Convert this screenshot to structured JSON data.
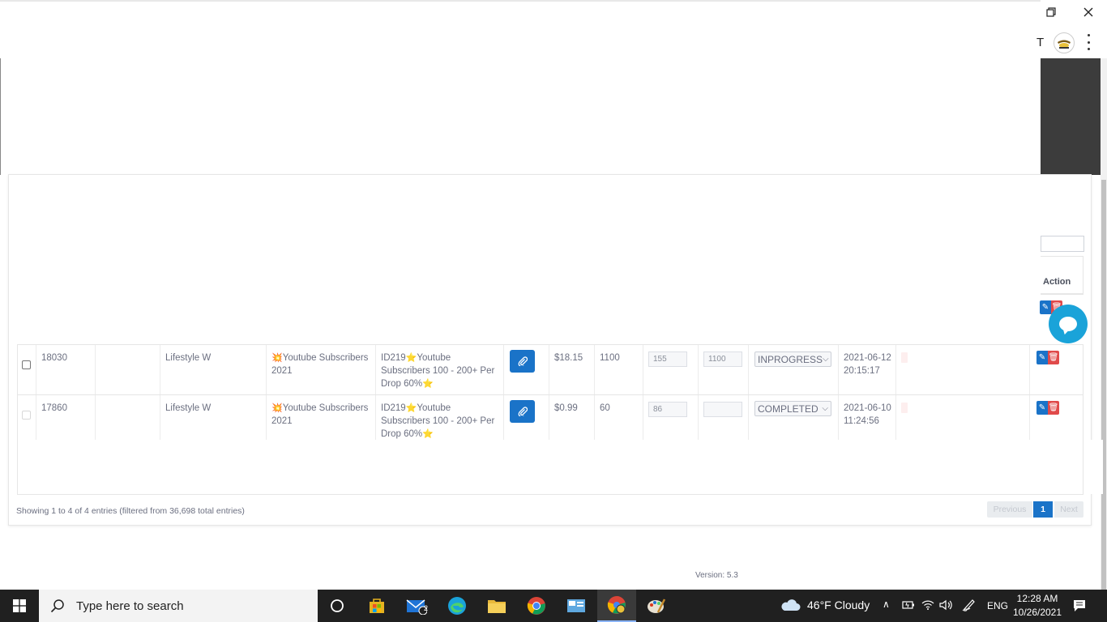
{
  "browser": {
    "partial_text": "T"
  },
  "table": {
    "action_header": "Action",
    "rows": [
      {
        "id": "18030",
        "user": "",
        "category": "Lifestyle W",
        "service_emoji": "💥",
        "service": "Youtube Subscribers 2021",
        "detail_prefix": "ID219",
        "detail_main": "Youtube Subscribers 100 - 200+ Per Drop 60%",
        "charge": "$18.15",
        "quantity": "1100",
        "start_count": "155",
        "remains": "1100",
        "status": "INPROGRESS",
        "date": "2021-06-12",
        "time": "20:15:17"
      },
      {
        "id": "17860",
        "user": "",
        "category": "Lifestyle W",
        "service_emoji": "💥",
        "service": "Youtube Subscribers 2021",
        "detail_prefix": "ID219",
        "detail_main": "Youtube Subscribers 100 - 200+ Per Drop 60%",
        "charge": "$0.99",
        "quantity": "60",
        "start_count": "86",
        "remains": "",
        "status": "COMPLETED",
        "date": "2021-06-10",
        "time": "11:24:56"
      }
    ]
  },
  "footer": {
    "showing": "Showing 1 to 4 of 4 entries (filtered from 36,698 total entries)",
    "previous": "Previous",
    "page": "1",
    "next": "Next",
    "version": "Version: 5.3"
  },
  "taskbar": {
    "search_placeholder": "Type here to search",
    "mail_badge": "2",
    "weather": "46°F  Cloudy",
    "language": "ENG",
    "time": "12:28 AM",
    "date": "10/26/2021"
  },
  "colors": {
    "primary": "#1a73c8",
    "danger": "#e04a4a",
    "chat": "#1aa3d9",
    "taskbar": "#202020"
  }
}
